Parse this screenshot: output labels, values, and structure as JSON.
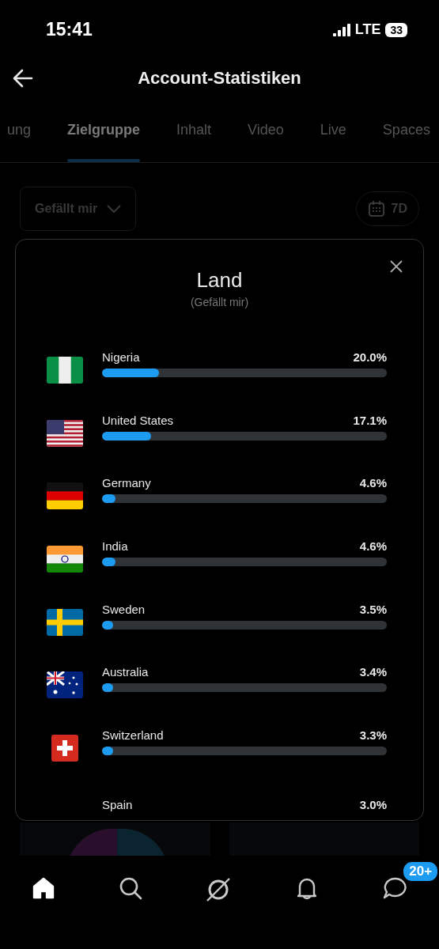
{
  "status_bar": {
    "time": "15:41",
    "network": "LTE",
    "battery": "33"
  },
  "header": {
    "title": "Account-Statistiken"
  },
  "tabs": [
    {
      "label": "ung",
      "selected": false
    },
    {
      "label": "Zielgruppe",
      "selected": true
    },
    {
      "label": "Inhalt",
      "selected": false
    },
    {
      "label": "Video",
      "selected": false
    },
    {
      "label": "Live",
      "selected": false
    },
    {
      "label": "Spaces",
      "selected": false
    }
  ],
  "filters": {
    "metric": "Gefällt mir",
    "period": "7D"
  },
  "modal": {
    "title": "Land",
    "subtitle": "(Gefällt mir)",
    "rows": [
      {
        "kind": "ng",
        "name": "Nigeria",
        "value": "20.0%",
        "level": 0.2
      },
      {
        "kind": "us",
        "name": "United States",
        "value": "17.1%",
        "level": 0.171
      },
      {
        "kind": "de",
        "name": "Germany",
        "value": "4.6%",
        "level": 0.046
      },
      {
        "kind": "in",
        "name": "India",
        "value": "4.6%",
        "level": 0.046
      },
      {
        "kind": "se",
        "name": "Sweden",
        "value": "3.5%",
        "level": 0.035
      },
      {
        "kind": "au",
        "name": "Australia",
        "value": "3.4%",
        "level": 0.034
      },
      {
        "kind": "ch",
        "name": "Switzerland",
        "value": "3.3%",
        "level": 0.033
      },
      {
        "kind": "none",
        "name": "Spain",
        "value": "3.0%"
      }
    ]
  },
  "bottom_nav": [
    {
      "kind": "home",
      "selected": true
    },
    {
      "kind": "search",
      "selected": false
    },
    {
      "kind": "grok",
      "selected": false
    },
    {
      "kind": "bell",
      "selected": false
    },
    {
      "kind": "messages",
      "selected": false,
      "badge": "20+"
    }
  ]
}
